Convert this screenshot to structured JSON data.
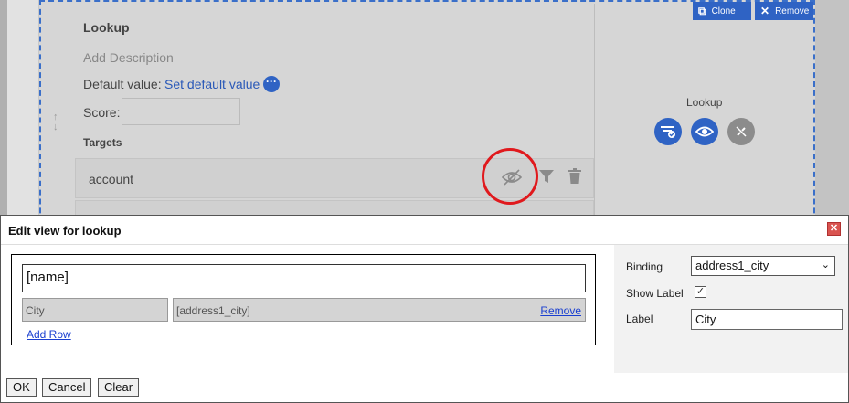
{
  "toolbar": {
    "clone_label": "Clone",
    "remove_label": "Remove"
  },
  "field": {
    "title": "Lookup",
    "add_description": "Add Description",
    "default_value_label": "Default value:",
    "default_value_link": "Set default value",
    "score_label": "Score:",
    "targets_label": "Targets",
    "targets": [
      "account"
    ]
  },
  "preview": {
    "label": "Lookup"
  },
  "dialog": {
    "title": "Edit view for lookup",
    "name_field": "[name]",
    "row": {
      "label": "City",
      "binding": "[address1_city]",
      "remove_link": "Remove"
    },
    "add_row": "Add Row",
    "props": {
      "binding_label": "Binding",
      "binding_value": "address1_city",
      "show_label_label": "Show Label",
      "show_label_checked": true,
      "label_label": "Label",
      "label_value": "City"
    },
    "buttons": {
      "ok": "OK",
      "cancel": "Cancel",
      "clear": "Clear"
    }
  },
  "colors": {
    "accent": "#2f63c4",
    "highlight_circle": "#e0191d",
    "link": "#1a3fd0"
  },
  "icons": [
    "move-arrows-icon",
    "eye-slash-icon",
    "filter-icon",
    "trash-icon",
    "clone-icon",
    "close-icon",
    "eye-icon",
    "no-link-icon",
    "filter-check-icon",
    "chevron-down-icon",
    "checkmark-icon"
  ]
}
